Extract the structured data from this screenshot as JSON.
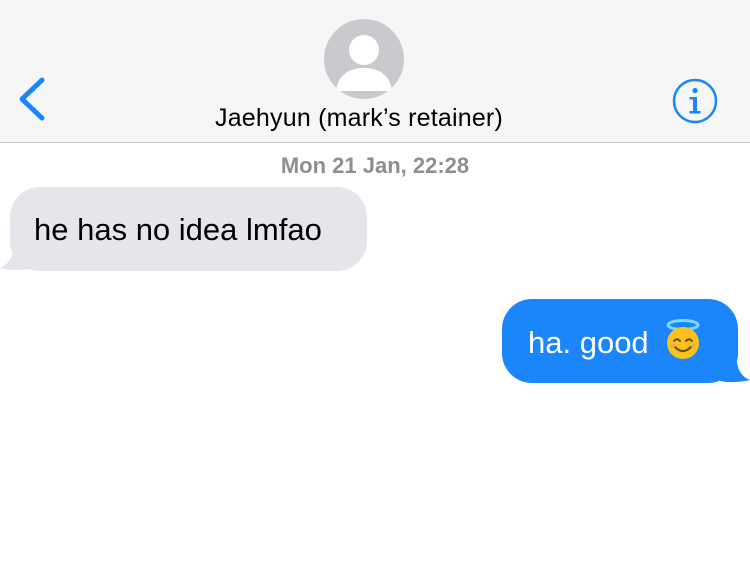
{
  "header": {
    "contact_name": "Jaehyun (mark’s retainer)",
    "back_icon": "chevron-left-icon",
    "info_icon": "info-circle-icon",
    "avatar_icon": "person-silhouette-icon"
  },
  "thread": {
    "timestamp": "Mon 21 Jan, 22:28",
    "messages": [
      {
        "direction": "incoming",
        "text": "he has no idea lmfao"
      },
      {
        "direction": "outgoing",
        "text": "ha. good",
        "emoji": "smiling-face-with-halo-emoji"
      }
    ]
  },
  "colors": {
    "accent": "#1b86fc",
    "incoming_bubble": "#e6e5eb",
    "header_bg": "#f6f6f7",
    "timestamp": "#8e8e93"
  }
}
